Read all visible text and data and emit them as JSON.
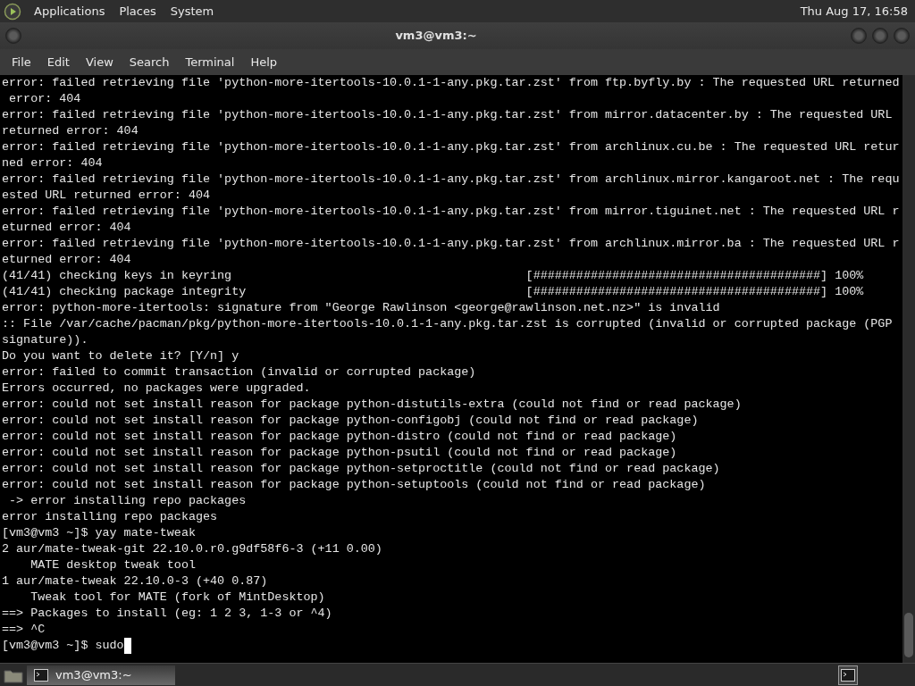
{
  "top_panel": {
    "menus": [
      "Applications",
      "Places",
      "System"
    ],
    "clock": "Thu Aug 17, 16:58"
  },
  "window": {
    "title": "vm3@vm3:~"
  },
  "menubar": [
    "File",
    "Edit",
    "View",
    "Search",
    "Terminal",
    "Help"
  ],
  "terminal": {
    "lines": [
      "error: failed retrieving file 'python-more-itertools-10.0.1-1-any.pkg.tar.zst' from ftp.byfly.by : The requested URL returned",
      " error: 404",
      "error: failed retrieving file 'python-more-itertools-10.0.1-1-any.pkg.tar.zst' from mirror.datacenter.by : The requested URL",
      "returned error: 404",
      "error: failed retrieving file 'python-more-itertools-10.0.1-1-any.pkg.tar.zst' from archlinux.cu.be : The requested URL retur",
      "ned error: 404",
      "error: failed retrieving file 'python-more-itertools-10.0.1-1-any.pkg.tar.zst' from archlinux.mirror.kangaroot.net : The requ",
      "ested URL returned error: 404",
      "error: failed retrieving file 'python-more-itertools-10.0.1-1-any.pkg.tar.zst' from mirror.tiguinet.net : The requested URL r",
      "eturned error: 404",
      "error: failed retrieving file 'python-more-itertools-10.0.1-1-any.pkg.tar.zst' from archlinux.mirror.ba : The requested URL r",
      "eturned error: 404",
      "(41/41) checking keys in keyring                                         [########################################] 100%",
      "(41/41) checking package integrity                                       [########################################] 100%",
      "error: python-more-itertools: signature from \"George Rawlinson <george@rawlinson.net.nz>\" is invalid",
      ":: File /var/cache/pacman/pkg/python-more-itertools-10.0.1-1-any.pkg.tar.zst is corrupted (invalid or corrupted package (PGP",
      "signature)).",
      "Do you want to delete it? [Y/n] y",
      "error: failed to commit transaction (invalid or corrupted package)",
      "Errors occurred, no packages were upgraded.",
      "error: could not set install reason for package python-distutils-extra (could not find or read package)",
      "error: could not set install reason for package python-configobj (could not find or read package)",
      "error: could not set install reason for package python-distro (could not find or read package)",
      "error: could not set install reason for package python-psutil (could not find or read package)",
      "error: could not set install reason for package python-setproctitle (could not find or read package)",
      "error: could not set install reason for package python-setuptools (could not find or read package)",
      " -> error installing repo packages",
      "error installing repo packages",
      "[vm3@vm3 ~]$ yay mate-tweak",
      "2 aur/mate-tweak-git 22.10.0.r0.g9df58f6-3 (+11 0.00)",
      "    MATE desktop tweak tool",
      "1 aur/mate-tweak 22.10.0-3 (+40 0.87)",
      "    Tweak tool for MATE (fork of MintDesktop)",
      "==> Packages to install (eg: 1 2 3, 1-3 or ^4)",
      "==> ^C",
      "[vm3@vm3 ~]$ sudo"
    ],
    "cursor": true
  },
  "taskbar": {
    "tasks": [
      {
        "label": "vm3@vm3:~",
        "selected": true
      }
    ]
  }
}
